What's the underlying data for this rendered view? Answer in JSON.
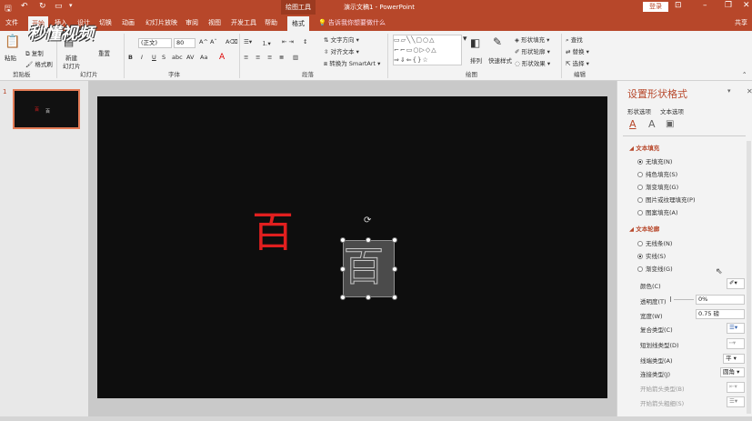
{
  "titlebar": {
    "context_group": "绘图工具",
    "document_title": "演示文稿1 - PowerPoint",
    "login_button": "登录"
  },
  "tabs": [
    "文件",
    "开始",
    "插入",
    "设计",
    "切换",
    "动画",
    "幻灯片放映",
    "审阅",
    "视图",
    "开发工具",
    "帮助",
    "格式"
  ],
  "tell_me": "告诉我你想要做什么",
  "share_label": "共享",
  "watermark_logo": "秒懂视频",
  "ribbon": {
    "clipboard": {
      "paste": "粘贴",
      "copy": "复制",
      "format_painter": "格式刷",
      "group_label": "剪贴板"
    },
    "slides": {
      "new_slide": "新建",
      "new_slide2": "幻灯片",
      "reset": "重置",
      "group_label": "幻灯片"
    },
    "font": {
      "font_name": "(正文)",
      "font_size": "80",
      "group_label": "字体"
    },
    "paragraph": {
      "text_direction": "文字方向",
      "align_text": "对齐文本",
      "smartart": "转换为 SmartArt",
      "group_label": "段落"
    },
    "drawing": {
      "arrange": "排列",
      "quick_styles": "快速样式",
      "shape_fill": "形状填充",
      "shape_outline": "形状轮廓",
      "shape_effects": "形状效果",
      "group_label": "绘图"
    },
    "editing": {
      "find": "查找",
      "replace": "替换",
      "select": "选择",
      "group_label": "编辑"
    }
  },
  "slide_panel": {
    "slide_number": "1"
  },
  "slide": {
    "text_red": "百",
    "text_outline": "百"
  },
  "format_pane": {
    "title": "设置形状格式",
    "tab_shape": "形状选项",
    "tab_text": "文本选项",
    "fill_section": "文本填充",
    "fill_options": [
      "无填充(N)",
      "纯色填充(S)",
      "渐变填充(G)",
      "图片或纹理填充(P)",
      "图案填充(A)"
    ],
    "fill_selected": 0,
    "outline_section": "文本轮廓",
    "outline_options": [
      "无线条(N)",
      "实线(S)",
      "渐变线(G)"
    ],
    "outline_selected": 1,
    "properties": {
      "color": "颜色(C)",
      "transparency": "透明度(T)",
      "transparency_value": "0%",
      "width": "宽度(W)",
      "width_value": "0.75 磅",
      "compound_type": "复合类型(C)",
      "dash_type": "短划线类型(D)",
      "cap_type": "线端类型(A)",
      "cap_value": "平",
      "join_type": "连接类型(J)",
      "join_value": "圆角",
      "begin_arrow_type": "开始箭头类型(B)",
      "begin_arrow_size": "开始箭头粗细(S)"
    }
  },
  "colors": {
    "brand": "#b7472a",
    "slide_bg": "#0e0e0e",
    "red_text": "#e01f1f"
  }
}
